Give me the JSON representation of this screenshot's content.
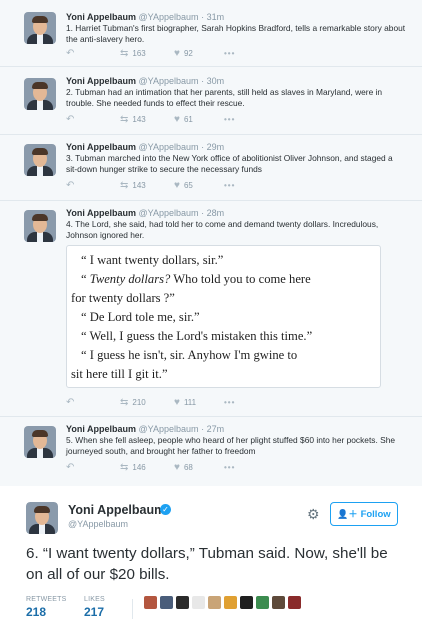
{
  "thread": [
    {
      "name": "Yoni Appelbaum",
      "handle": "@YAppelbaum",
      "time": "31m",
      "text": "1. Harriet Tubman's first biographer, Sarah Hopkins Bradford, tells a remarkable story about the anti-slavery hero.",
      "retweets": "163",
      "likes": "92"
    },
    {
      "name": "Yoni Appelbaum",
      "handle": "@YAppelbaum",
      "time": "30m",
      "text": "2. Tubman had an intimation that her parents, still held as slaves in Maryland, were in trouble. She needed funds to effect their rescue.",
      "retweets": "143",
      "likes": "61"
    },
    {
      "name": "Yoni Appelbaum",
      "handle": "@YAppelbaum",
      "time": "29m",
      "text": "3. Tubman marched into the New York office of abolitionist Oliver Johnson, and staged a sit-down hunger strike to secure the necessary funds",
      "retweets": "143",
      "likes": "65"
    },
    {
      "name": "Yoni Appelbaum",
      "handle": "@YAppelbaum",
      "time": "28m",
      "text": "4. The Lord, she said, had told her to come and demand twenty dollars. Incredulous, Johnson ignored her.",
      "retweets": "210",
      "likes": "111"
    },
    {
      "name": "Yoni Appelbaum",
      "handle": "@YAppelbaum",
      "time": "27m",
      "text": "5. When she fell asleep, people who heard of her plight stuffed $60 into her pockets. She journeyed south, and brought her father to freedom",
      "retweets": "146",
      "likes": "68"
    }
  ],
  "time_separator": "·",
  "more_dots": "•••",
  "quote_image": {
    "line1": "“ I want twenty dollars, sir.”",
    "line2_open": "“ ",
    "line2_italic": "Twenty dollars?",
    "line2_rest": "  Who told you to come here",
    "line3": "for twenty dollars ?”",
    "line4": "“ De Lord tole me, sir.”",
    "line5": "“ Well, I guess the Lord's mistaken this time.”",
    "line6": "“ I guess he isn't, sir.  Anyhow I'm gwine to",
    "line7": "sit here till I git it.”"
  },
  "main_tweet": {
    "name": "Yoni Appelbaum",
    "handle": "@YAppelbaum",
    "follow_label": "Follow",
    "text": "6. “I want twenty dollars,” Tubman said. Now, she'll be on all of our $20 bills.",
    "retweets_label": "RETWEETS",
    "retweets_value": "218",
    "likes_label": "LIKES",
    "likes_value": "217"
  },
  "icons": {
    "reply": "reply-icon",
    "retweet": "retweet-icon",
    "like": "heart-icon",
    "more": "more-icon",
    "gear": "gear-icon",
    "verified": "verified-badge-icon",
    "follow": "add-user-icon"
  },
  "colors": {
    "accent": "#1da1f2",
    "thread_bg": "#f5f8fa",
    "muted": "#8899a6",
    "stat_value": "#1b6da8"
  },
  "liker_avatar_colors": [
    "#b3563f",
    "#4a5d7a",
    "#2b2b2b",
    "#e8e8e8",
    "#c9a477",
    "#e0a032",
    "#1f1f1f",
    "#3c8c4f",
    "#5e4a3a",
    "#8a2b2b"
  ]
}
